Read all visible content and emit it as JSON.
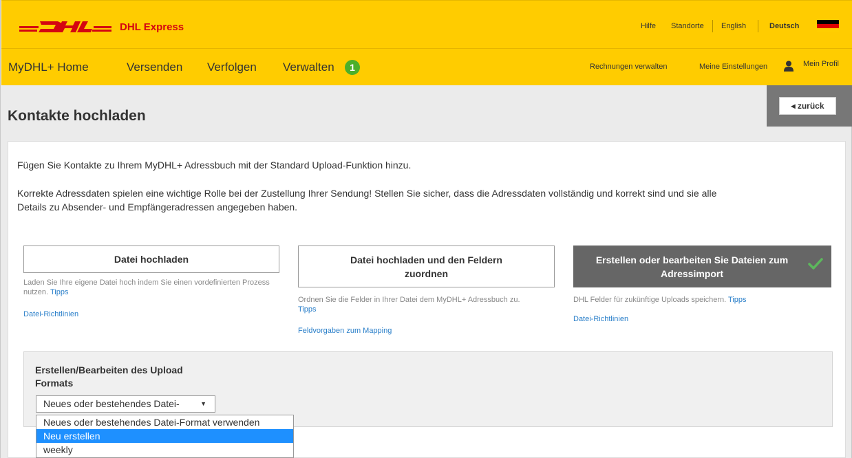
{
  "header": {
    "brand": "DHL Express",
    "utility": [
      "Hilfe",
      "Standorte",
      "English",
      "Deutsch"
    ]
  },
  "nav": {
    "items": [
      "MyDHL+ Home",
      "Versenden",
      "Verfolgen",
      "Verwalten"
    ],
    "badge": "1",
    "right": [
      "Rechnungen verwalten",
      "Meine Einstellungen",
      "Mein Profil"
    ]
  },
  "page": {
    "title": "Kontakte hochladen",
    "back_label": "◂ zurück"
  },
  "intro": {
    "line1": "Fügen Sie Kontakte zu Ihrem MyDHL+ Adressbuch mit der Standard Upload-Funktion hinzu.",
    "line2a": "Korrekte Adressdaten spielen eine wichtige Rolle bei der Zustellung Ihrer Sendung! Stellen Sie sicher, dass die Adressdaten vollständig und korrekt sind und sie alle",
    "line2b": "Details zu Absender- und Empfängeradressen angegeben haben."
  },
  "options": [
    {
      "label": "Datei hochladen",
      "desc": "Laden Sie Ihre eigene Datei hoch indem Sie einen vordefinierten Prozess nutzen.",
      "tips": "Tipps",
      "link": "Datei-Richtlinien"
    },
    {
      "label_line1": "Datei hochladen und den Feldern",
      "label_line2": "zuordnen",
      "desc": "Ordnen Sie die Felder in Ihrer Datei dem MyDHL+ Adressbuch zu.",
      "tips": "Tipps",
      "link": "Feldvorgaben zum Mapping"
    },
    {
      "label_line1": "Erstellen oder bearbeiten Sie Dateien zum",
      "label_line2": "Adressimport",
      "desc": "DHL Felder für zukünftige Uploads speichern.",
      "tips": "Tipps",
      "link": "Datei-Richtlinien"
    }
  ],
  "format": {
    "label": "Erstellen/Bearbeiten des Upload Formats",
    "selected": "Neues oder bestehendes Datei-",
    "options": [
      "Neues oder bestehendes Datei-Format verwenden",
      "Neu erstellen",
      "weekly"
    ],
    "highlighted_index": 1
  },
  "colors": {
    "dhl_yellow": "#ffcc00",
    "dhl_red": "#d40511",
    "link_blue": "#2a7fc9",
    "highlight": "#1e90ff"
  }
}
